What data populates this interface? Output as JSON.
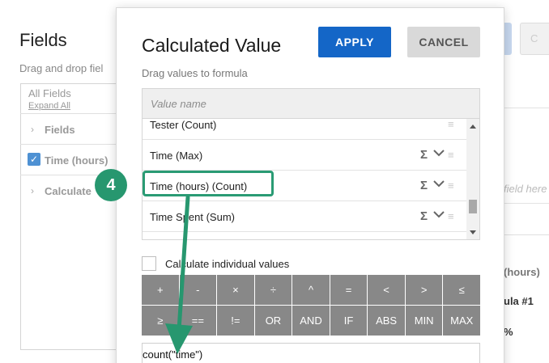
{
  "background": {
    "title": "Fields",
    "subtitle": "Drag and drop fiel",
    "all_fields": "All Fields",
    "expand_all": "Expand All",
    "rows": [
      {
        "label": "Fields",
        "checked": false
      },
      {
        "label": "Time (hours)",
        "checked": true
      },
      {
        "label": "Calculate",
        "checked": false
      }
    ],
    "btn_partial": "C",
    "right_texts": {
      "field_here": "field here",
      "hours": "(hours)",
      "ula": "ula #1",
      "pct": "%"
    }
  },
  "modal": {
    "title": "Calculated Value",
    "subtitle": "Drag values to formula",
    "apply_label": "APPLY",
    "cancel_label": "CANCEL",
    "search_placeholder": "Value name",
    "items": [
      {
        "label": "Tester (Count)"
      },
      {
        "label": "Time (Max)"
      },
      {
        "label": "Time (hours) (Count)"
      },
      {
        "label": "Time Spent (Sum)"
      }
    ],
    "sigma": "Σ",
    "drag_glyph": "≡",
    "calc_individual_label": "Calculate individual values",
    "operators": [
      "+",
      "-",
      "×",
      "÷",
      "^",
      "=",
      "<",
      ">",
      "≤",
      "≥",
      "==",
      "!=",
      "OR",
      "AND",
      "IF",
      "ABS",
      "MIN",
      "MAX"
    ],
    "formula": "count(\"time\")"
  },
  "annotation": {
    "step_number": "4",
    "accent_color": "#27976f"
  },
  "colors": {
    "apply_bg": "#1466c7",
    "operator_bg": "#888888"
  }
}
